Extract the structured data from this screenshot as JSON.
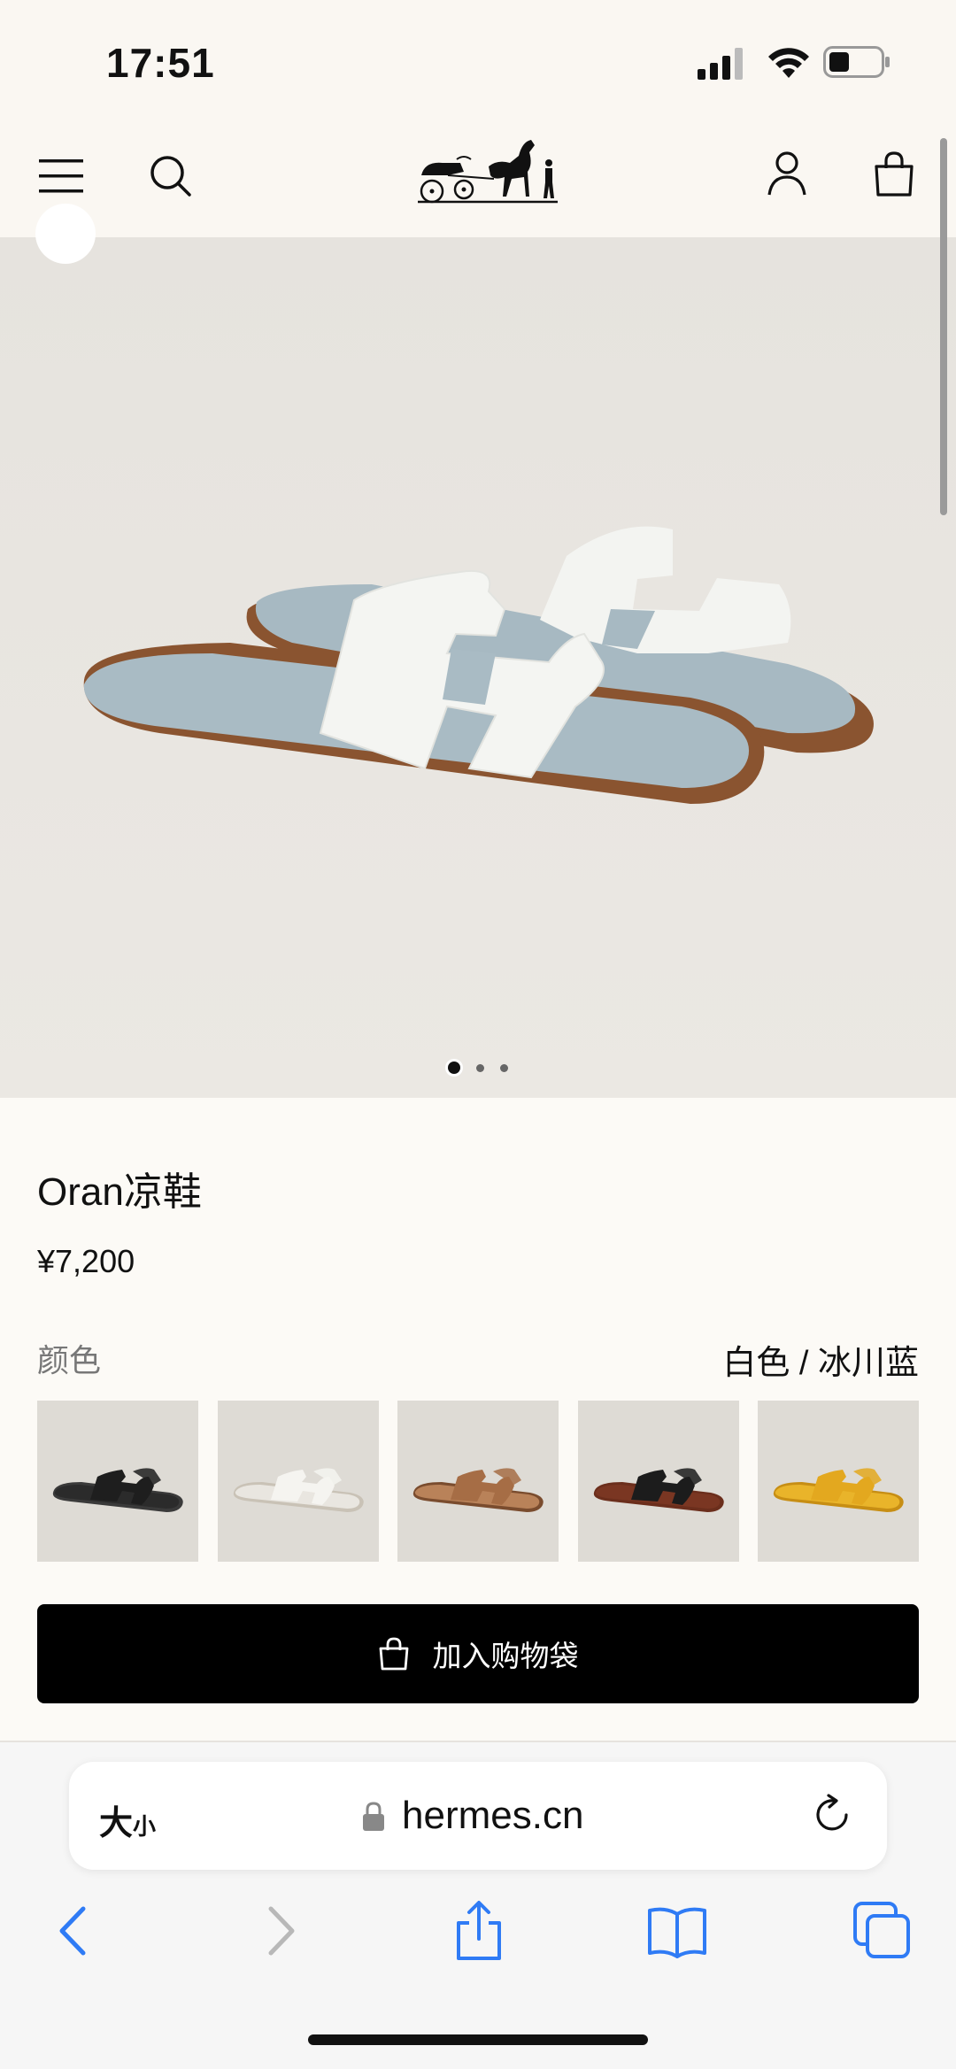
{
  "status_bar": {
    "time": "17:51"
  },
  "product": {
    "name": "Oran凉鞋",
    "price": "¥7,200",
    "color_label": "颜色",
    "color_value": "白色 / 冰川蓝"
  },
  "swatches": [
    {
      "name": "black",
      "upper": "#1e1e1e",
      "sole": "#3a3a3a",
      "footbed": "#2b2b2b"
    },
    {
      "name": "white",
      "upper": "#f5f4f0",
      "sole": "#c9c2b6",
      "footbed": "#e9e6e0"
    },
    {
      "name": "tan",
      "upper": "#a66d45",
      "sole": "#7a4c2e",
      "footbed": "#b98259"
    },
    {
      "name": "black-brown",
      "upper": "#1c1c1c",
      "sole": "#6b2e1c",
      "footbed": "#7a3622"
    },
    {
      "name": "yellow",
      "upper": "#e3a81f",
      "sole": "#c78e14",
      "footbed": "#e9b42a"
    }
  ],
  "actions": {
    "add_to_bag": "加入购物袋"
  },
  "browser": {
    "text_size_big": "大",
    "text_size_small": "小",
    "url": "hermes.cn"
  },
  "carousel": {
    "index": 1,
    "count": 3
  },
  "icons": {
    "menu": "menu-icon",
    "search": "search-icon",
    "account": "account-icon",
    "bag": "shopping-bag-icon",
    "back": "back-icon",
    "forward": "forward-icon",
    "share": "share-icon",
    "bookmarks": "bookmarks-icon",
    "tabs": "tabs-icon"
  }
}
